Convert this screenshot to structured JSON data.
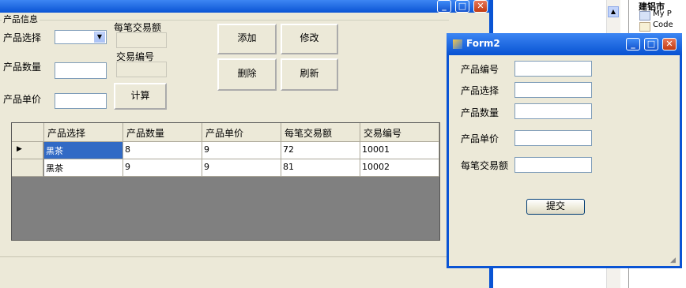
{
  "main": {
    "group_title": "产品信息",
    "labels": {
      "product_select": "产品选择",
      "product_qty": "产品数量",
      "product_price": "产品单价",
      "per_trade_amount": "每笔交易额",
      "trade_no": "交易编号"
    },
    "buttons": {
      "add": "添加",
      "modify": "修改",
      "delete": "删除",
      "refresh": "刷新",
      "calc": "计算"
    },
    "grid": {
      "headers": [
        "产品选择",
        "产品数量",
        "产品单价",
        "每笔交易额",
        "交易编号"
      ],
      "rows": [
        [
          "黑茶",
          "8",
          "9",
          "72",
          "10001"
        ],
        [
          "黑茶",
          "9",
          "9",
          "81",
          "10002"
        ]
      ]
    }
  },
  "window_buttons": {
    "minimize": "_",
    "maximize": "□",
    "close": "✕"
  },
  "tree": {
    "items": [
      "建铝市",
      "My P",
      "Code"
    ]
  },
  "form2": {
    "title": "Form2",
    "labels": {
      "product_no": "产品编号",
      "product_select": "产品选择",
      "product_qty": "产品数量",
      "product_price": "产品单价",
      "per_trade_amount": "每笔交易额"
    },
    "submit": "提交"
  }
}
